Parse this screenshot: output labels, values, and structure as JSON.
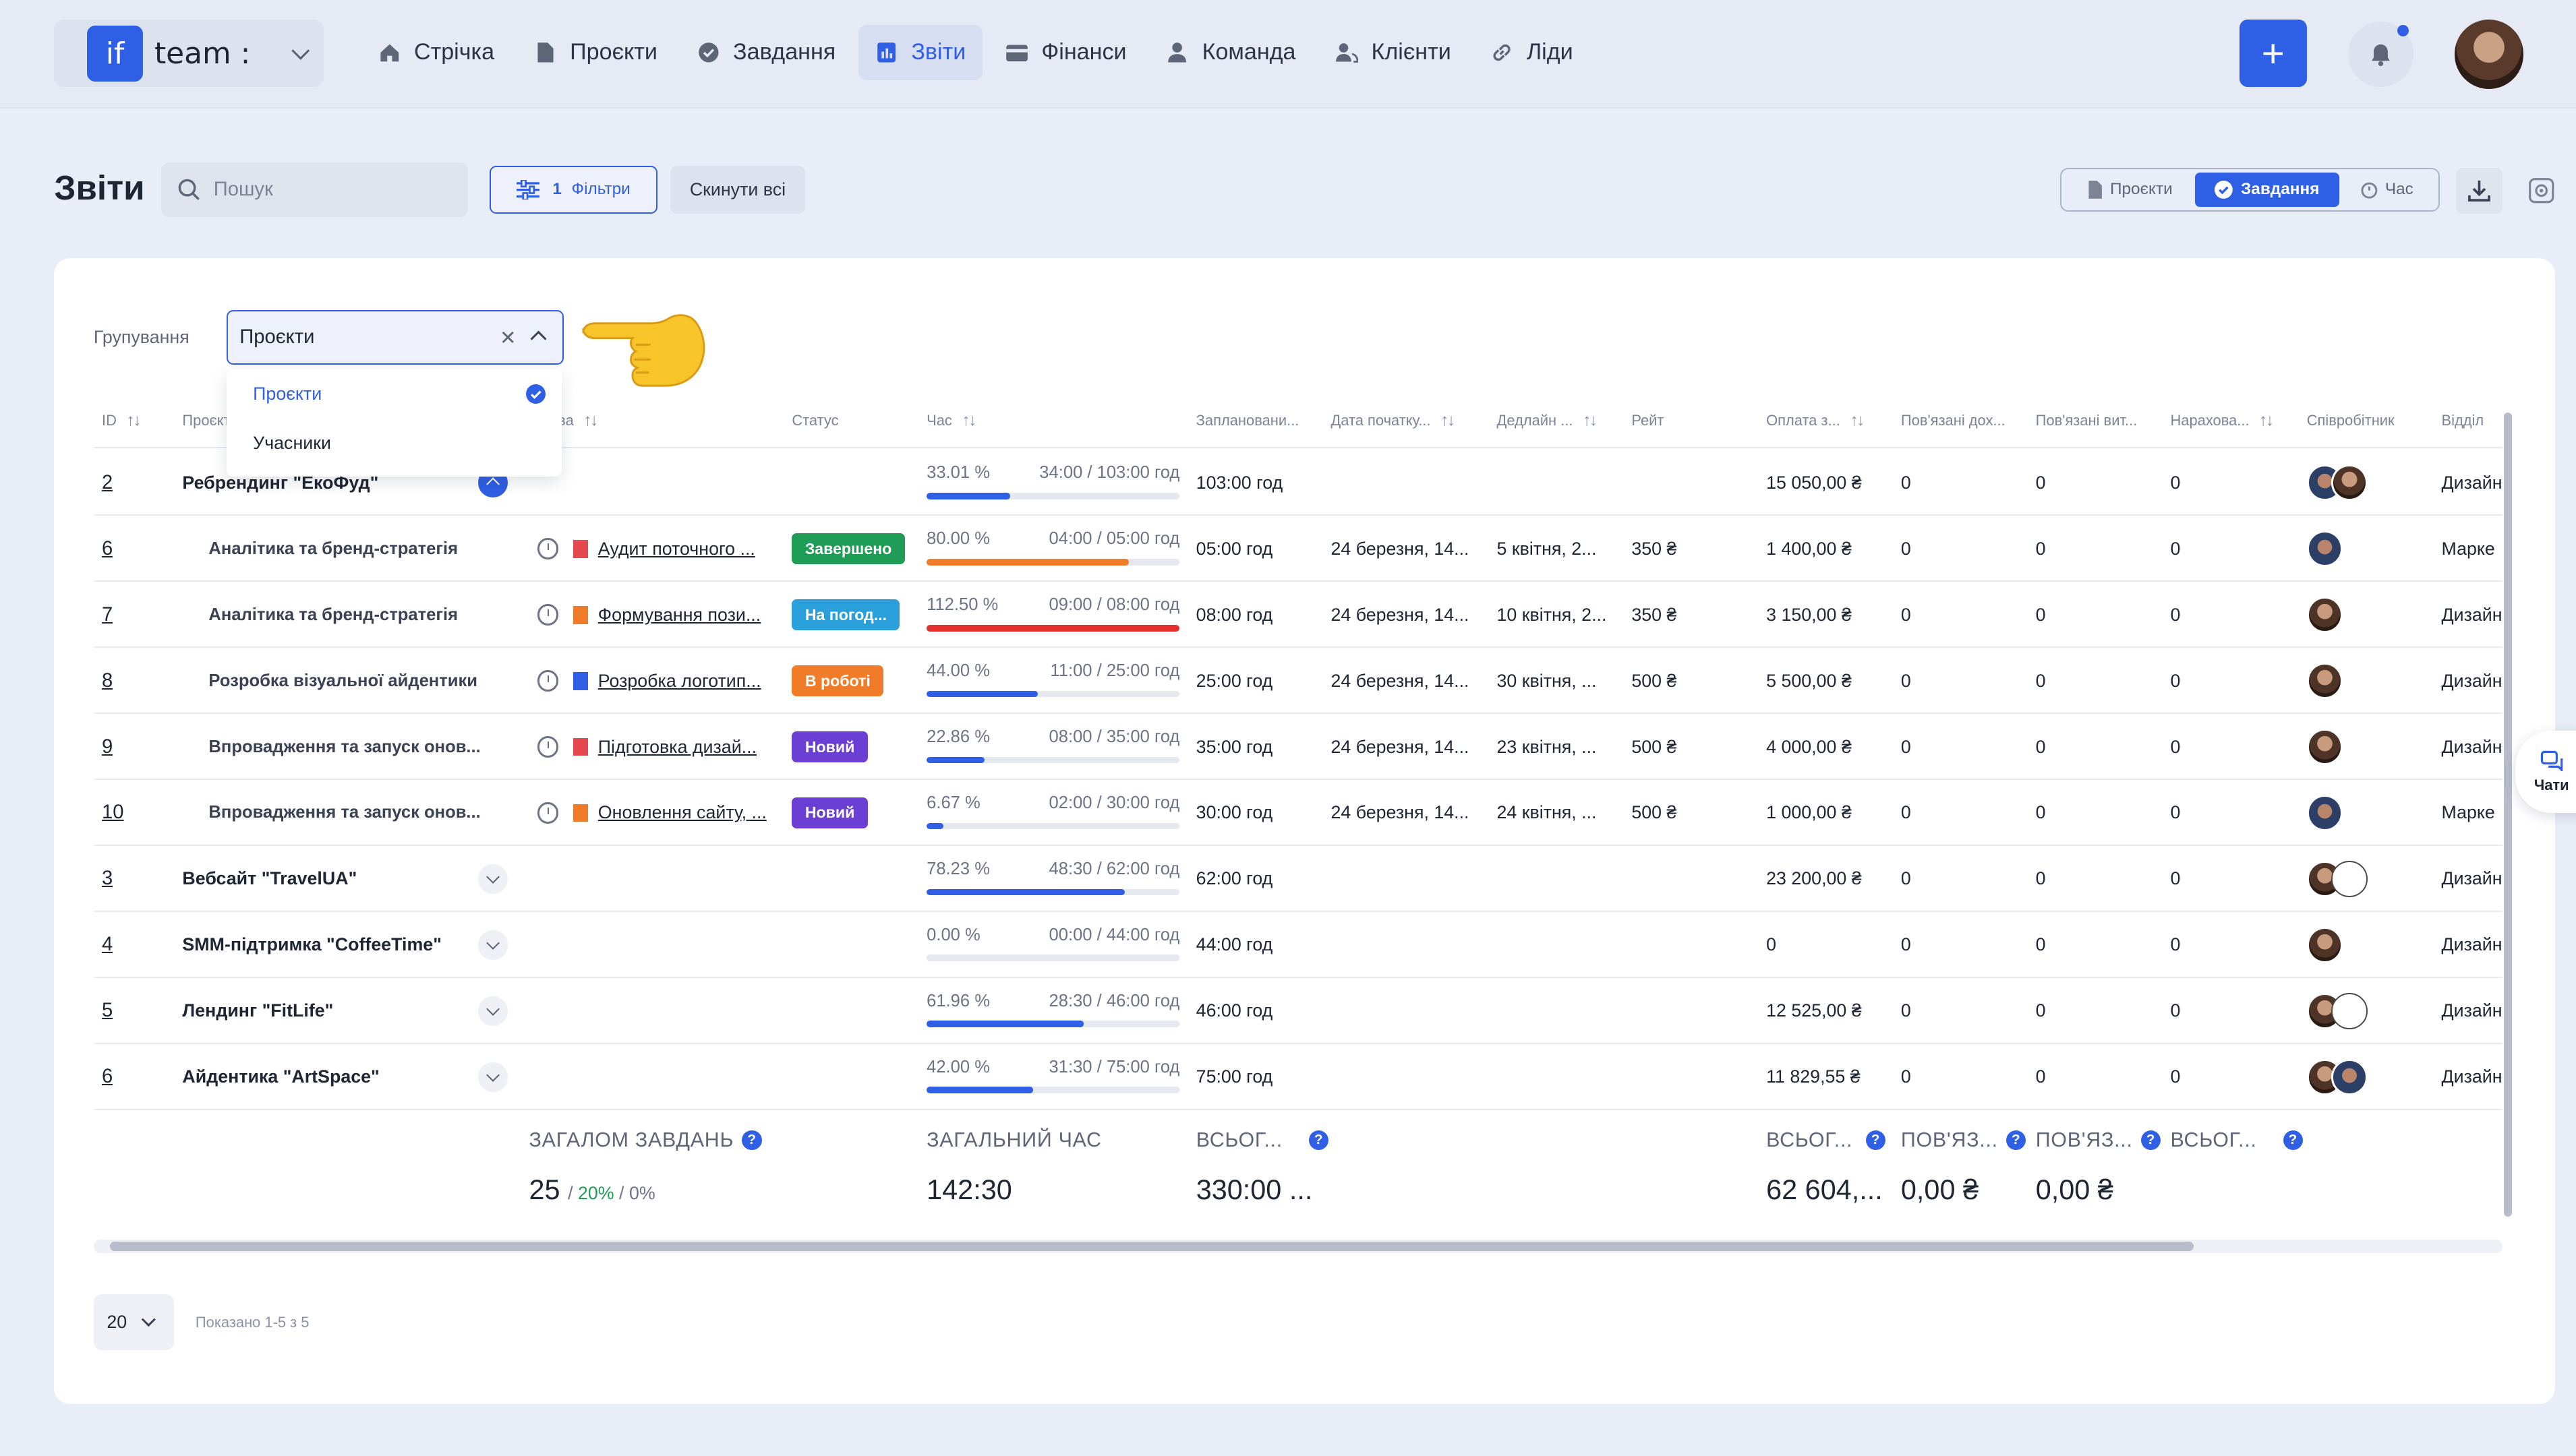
{
  "app": {
    "logo": "if",
    "team": "team :"
  },
  "nav": [
    {
      "label": "Стрічка",
      "icon": "home-icon"
    },
    {
      "label": "Проєкти",
      "icon": "file-icon"
    },
    {
      "label": "Завдання",
      "icon": "check-circle-icon"
    },
    {
      "label": "Звіти",
      "icon": "report-icon",
      "active": true
    },
    {
      "label": "Фінанси",
      "icon": "wallet-icon"
    },
    {
      "label": "Команда",
      "icon": "user-icon"
    },
    {
      "label": "Клієнти",
      "icon": "clients-icon"
    },
    {
      "label": "Ліди",
      "icon": "link-icon"
    }
  ],
  "header": {
    "title": "Звіти",
    "search_placeholder": "Пошук",
    "filters_count": "1",
    "filters_label": "Фільтри",
    "reset_label": "Скинути всі",
    "view_tabs": [
      {
        "label": "Проєкти",
        "icon": "file-icon"
      },
      {
        "label": "Завдання",
        "icon": "check-circle-icon",
        "active": true
      },
      {
        "label": "Час",
        "icon": "timer-icon"
      }
    ]
  },
  "grouping": {
    "label": "Групування",
    "value": "Проєкти",
    "options": [
      "Проєкти",
      "Учасники"
    ]
  },
  "columns": [
    "ID",
    "Проєкт",
    "Назва",
    "Статус",
    "Час",
    "Заплановани...",
    "Дата початку...",
    "Дедлайн ...",
    "Рейт",
    "Оплата з...",
    "Пов'язані дох...",
    "Пов'язані вит...",
    "Нарахова...",
    "Співробітник",
    "Відділ"
  ],
  "rows": [
    {
      "id": "2",
      "type": "project",
      "project": "Ребрендинг \"ЕкоФуд\"",
      "expanded": true,
      "pct": "33.01 %",
      "time": "34:00 / 103:00 год",
      "fill": 0.3301,
      "bar_color": "#2f5fe4",
      "planned": "103:00 год",
      "start": "",
      "deadline": "",
      "rate": "",
      "pay": "15 050,00 ₴",
      "inc": "0",
      "exp": "0",
      "acc": "0",
      "avatars": [
        "m1",
        "f1"
      ],
      "dept": "Дизайн"
    },
    {
      "id": "6",
      "type": "task",
      "project": "Аналітика та бренд-стратегія",
      "task": "Аудит поточного ...",
      "flag_color": "#e5484d",
      "status": "Завершено",
      "status_color": "#1f9d57",
      "pct": "80.00 %",
      "time": "04:00 / 05:00 год",
      "fill": 0.8,
      "bar_color": "#f07c2a",
      "planned": "05:00 год",
      "start": "24 березня, 14...",
      "deadline": "5 квітня, 2...",
      "rate": "350 ₴",
      "pay": "1 400,00 ₴",
      "inc": "0",
      "exp": "0",
      "acc": "0",
      "avatars": [
        "m1"
      ],
      "dept": "Марке"
    },
    {
      "id": "7",
      "type": "task",
      "project": "Аналітика та бренд-стратегія",
      "task": "Формування пози...",
      "flag_color": "#f07c2a",
      "status": "На погод...",
      "status_color": "#2b9fd9",
      "pct": "112.50 %",
      "time": "09:00 / 08:00 год",
      "fill": 1.0,
      "bar_color": "#e5312e",
      "planned": "08:00 год",
      "start": "24 березня, 14...",
      "deadline": "10 квітня, 2...",
      "rate": "350 ₴",
      "pay": "3 150,00 ₴",
      "inc": "0",
      "exp": "0",
      "acc": "0",
      "avatars": [
        "f1"
      ],
      "dept": "Дизайн"
    },
    {
      "id": "8",
      "type": "task",
      "project": "Розробка візуальної айдентики",
      "task": "Розробка логотип...",
      "flag_color": "#2f5fe4",
      "status": "В роботі",
      "status_color": "#f07c2a",
      "pct": "44.00 %",
      "time": "11:00 / 25:00 год",
      "fill": 0.44,
      "bar_color": "#2f5fe4",
      "planned": "25:00 год",
      "start": "24 березня, 14...",
      "deadline": "30 квітня, ...",
      "rate": "500 ₴",
      "pay": "5 500,00 ₴",
      "inc": "0",
      "exp": "0",
      "acc": "0",
      "avatars": [
        "f1"
      ],
      "dept": "Дизайн"
    },
    {
      "id": "9",
      "type": "task",
      "project": "Впровадження та запуск онов...",
      "task": "Підготовка дизай...",
      "flag_color": "#e5484d",
      "status": "Новий",
      "status_color": "#6c3fd4",
      "pct": "22.86 %",
      "time": "08:00 / 35:00 год",
      "fill": 0.2286,
      "bar_color": "#2f5fe4",
      "planned": "35:00 год",
      "start": "24 березня, 14...",
      "deadline": "23 квітня, ...",
      "rate": "500 ₴",
      "pay": "4 000,00 ₴",
      "inc": "0",
      "exp": "0",
      "acc": "0",
      "avatars": [
        "f1"
      ],
      "dept": "Дизайн"
    },
    {
      "id": "10",
      "type": "task",
      "project": "Впровадження та запуск онов...",
      "task": "Оновлення сайту, ...",
      "flag_color": "#f07c2a",
      "status": "Новий",
      "status_color": "#6c3fd4",
      "pct": "6.67 %",
      "time": "02:00 / 30:00 год",
      "fill": 0.0667,
      "bar_color": "#2f5fe4",
      "planned": "30:00 год",
      "start": "24 березня, 14...",
      "deadline": "24 квітня, ...",
      "rate": "500 ₴",
      "pay": "1 000,00 ₴",
      "inc": "0",
      "exp": "0",
      "acc": "0",
      "avatars": [
        "m1"
      ],
      "dept": "Марке"
    },
    {
      "id": "3",
      "type": "project",
      "project": "Вебсайт \"TravelUA\"",
      "expanded": false,
      "pct": "78.23 %",
      "time": "48:30 / 62:00 год",
      "fill": 0.7823,
      "bar_color": "#2f5fe4",
      "planned": "62:00 год",
      "start": "",
      "deadline": "",
      "rate": "",
      "pay": "23 200,00 ₴",
      "inc": "0",
      "exp": "0",
      "acc": "0",
      "avatars": [
        "f1",
        "d1"
      ],
      "dept": "Дизайн"
    },
    {
      "id": "4",
      "type": "project",
      "project": "SMM-підтримка \"CoffeeTime\"",
      "expanded": false,
      "pct": "0.00 %",
      "time": "00:00 / 44:00 год",
      "fill": 0.0,
      "bar_color": "#2f5fe4",
      "planned": "44:00 год",
      "start": "",
      "deadline": "",
      "rate": "",
      "pay": "0",
      "inc": "0",
      "exp": "0",
      "acc": "0",
      "avatars": [
        "f1"
      ],
      "dept": "Дизайн"
    },
    {
      "id": "5",
      "type": "project",
      "project": "Лендинг \"FitLife\"",
      "expanded": false,
      "pct": "61.96 %",
      "time": "28:30 / 46:00 год",
      "fill": 0.6196,
      "bar_color": "#2f5fe4",
      "planned": "46:00 год",
      "start": "",
      "deadline": "",
      "rate": "",
      "pay": "12 525,00 ₴",
      "inc": "0",
      "exp": "0",
      "acc": "0",
      "avatars": [
        "f1",
        "d1"
      ],
      "dept": "Дизайн"
    },
    {
      "id": "6",
      "type": "project",
      "project": "Айдентика \"ArtSpace\"",
      "expanded": false,
      "pct": "42.00 %",
      "time": "31:30 / 75:00 год",
      "fill": 0.42,
      "bar_color": "#2f5fe4",
      "planned": "75:00 год",
      "start": "",
      "deadline": "",
      "rate": "",
      "pay": "11 829,55 ₴",
      "inc": "0",
      "exp": "0",
      "acc": "0",
      "avatars": [
        "f1",
        "m1"
      ],
      "dept": "Дизайн"
    }
  ],
  "summary": {
    "total_tasks_label": "ЗАГАЛОМ ЗАВДАНЬ",
    "total_tasks_value": "25",
    "total_tasks_pct1": "20%",
    "total_tasks_pct2": "0%",
    "total_time_label": "ЗАГАЛЬНИЙ ЧАС",
    "total_time_value": "142:30",
    "planned_label": "ВСЬОГ...",
    "planned_value": "330:00 ...",
    "pay_label": "ВСЬОГ...",
    "pay_value": "62 604,...",
    "inc_label": "ПОВ'ЯЗ...",
    "inc_value": "0,00 ₴",
    "exp_label": "ПОВ'ЯЗ...",
    "exp_value": "0,00 ₴",
    "acc_label": "ВСЬОГ..."
  },
  "pagination": {
    "page_size": "20",
    "info": "Показано 1-5 з 5"
  },
  "chat": {
    "label": "Чати"
  }
}
